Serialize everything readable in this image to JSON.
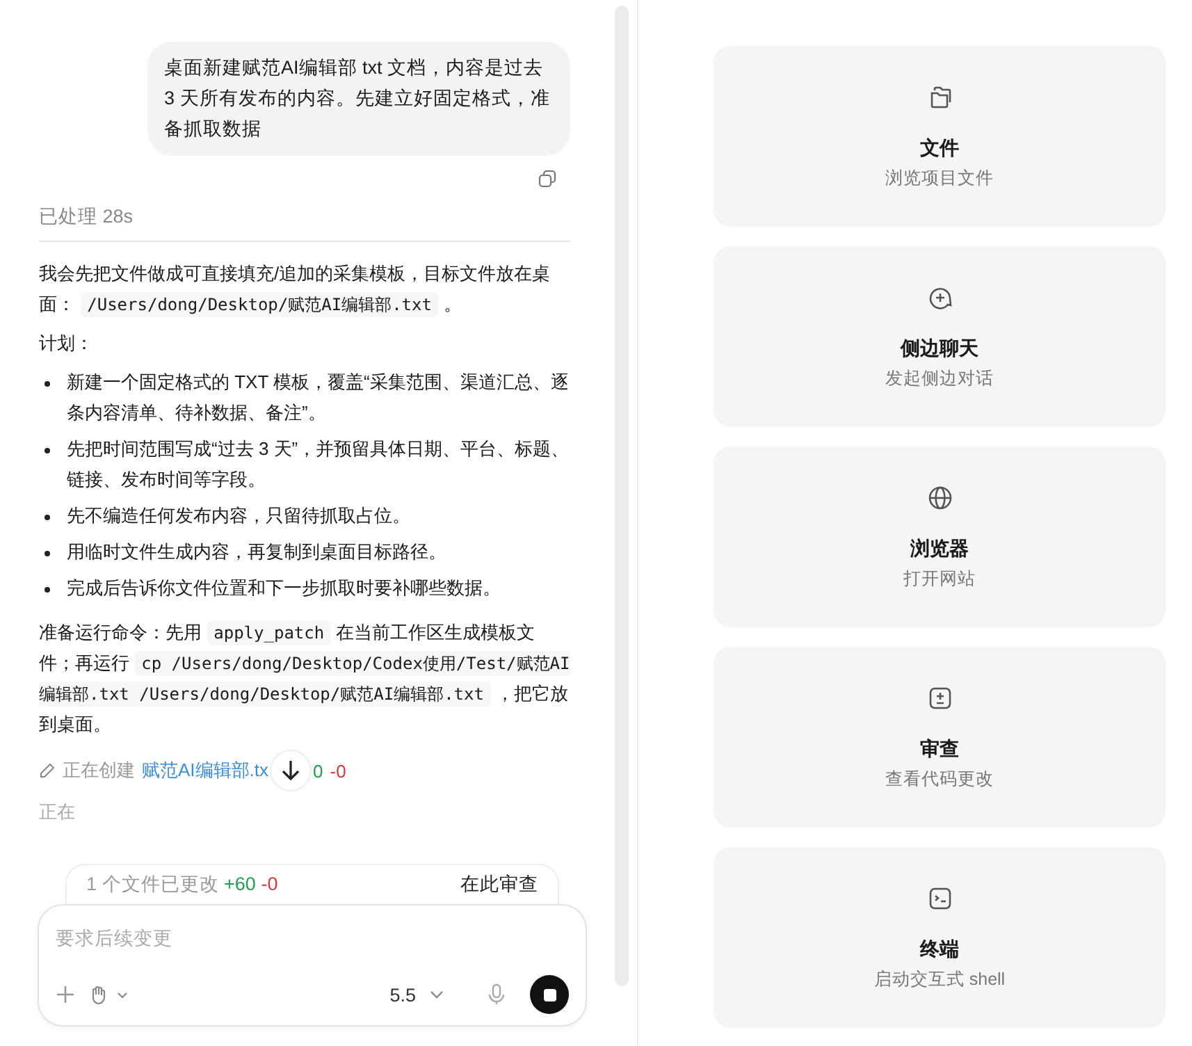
{
  "user_message": {
    "text": "桌面新建赋范AI编辑部 txt 文档，内容是过去 3 天所有发布的内容。先建立好固定格式，准备抓取数据"
  },
  "status": "已处理 28s",
  "intro": [
    {
      "kind": "text",
      "text": "我会先把文件做成可直接填充/追加的采集模板，目标文件放在桌面： "
    },
    {
      "kind": "code",
      "text": "/Users/dong/Desktop/赋范AI编辑部.txt"
    },
    {
      "kind": "text",
      "text": " 。"
    }
  ],
  "plan_label": "计划：",
  "bullets": [
    "新建一个固定格式的 TXT 模板，覆盖“采集范围、渠道汇总、逐条内容清单、待补数据、备注”。",
    "先把时间范围写成“过去 3 天”，并预留具体日期、平台、标题、链接、发布时间等字段。",
    "先不编造任何发布内容，只留待抓取占位。",
    "用临时文件生成内容，再复制到桌面目标路径。",
    "完成后告诉你文件位置和下一步抓取时要补哪些数据。"
  ],
  "command": [
    {
      "kind": "text",
      "text": "准备运行命令：先用 "
    },
    {
      "kind": "code",
      "text": "apply_patch"
    },
    {
      "kind": "text",
      "text": " 在当前工作区生成模板文件；再运行 "
    },
    {
      "kind": "code",
      "text": "cp /Users/dong/Desktop/Codex使用/Test/赋范AI编辑部.txt /Users/dong/Desktop/赋范AI编辑部.txt"
    },
    {
      "kind": "text",
      "text": " ，把它放到桌面。"
    }
  ],
  "activity": {
    "verb": "正在创建",
    "file": "赋范AI编辑部.tx",
    "added": "0",
    "removed": "-0"
  },
  "thinking": "正在",
  "changes_bar": {
    "summary": "1 个文件已更改",
    "added": "+60",
    "removed": "-0",
    "action": "在此审查"
  },
  "composer": {
    "placeholder": "要求后续变更",
    "model": "5.5"
  },
  "tools": [
    {
      "kind": "files",
      "title": "文件",
      "subtitle": "浏览项目文件"
    },
    {
      "kind": "chat",
      "title": "侧边聊天",
      "subtitle": "发起侧边对话"
    },
    {
      "kind": "browser",
      "title": "浏览器",
      "subtitle": "打开网站"
    },
    {
      "kind": "review",
      "title": "审查",
      "subtitle": "查看代码更改"
    },
    {
      "kind": "terminal",
      "title": "终端",
      "subtitle": "启动交互式 shell"
    }
  ]
}
